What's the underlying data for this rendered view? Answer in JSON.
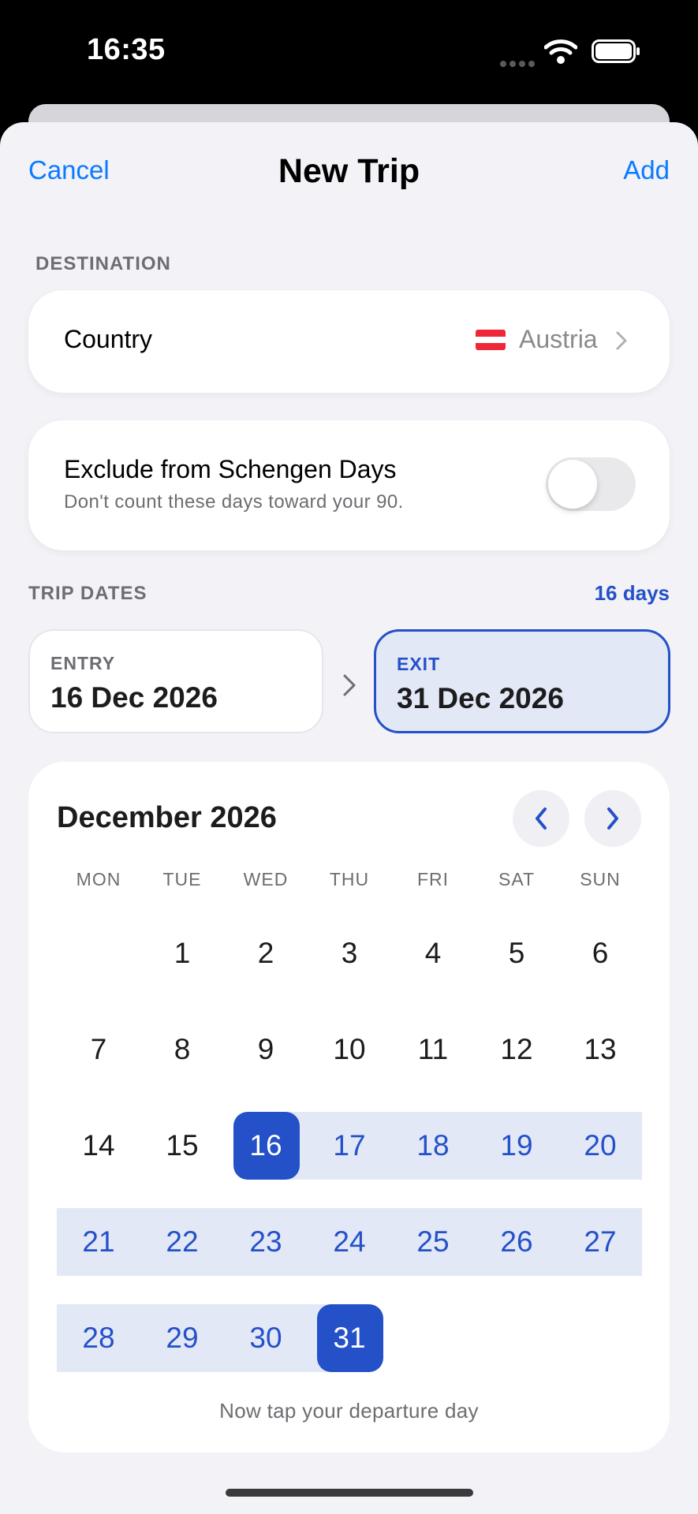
{
  "status_bar": {
    "time": "16:35"
  },
  "nav": {
    "cancel_label": "Cancel",
    "title": "New Trip",
    "add_label": "Add"
  },
  "destination": {
    "section_label": "DESTINATION",
    "country_label": "Country",
    "country_value": "Austria",
    "flag_colors": [
      "#ed2939",
      "#ffffff",
      "#ed2939"
    ]
  },
  "exclude": {
    "title": "Exclude from Schengen Days",
    "subtitle": "Don't count these days toward your 90.",
    "toggle_on": false
  },
  "trip_dates": {
    "section_label": "TRIP DATES",
    "days_count": "16 days",
    "entry": {
      "label": "ENTRY",
      "value": "16 Dec 2026"
    },
    "exit": {
      "label": "EXIT",
      "value": "31 Dec 2026"
    }
  },
  "calendar": {
    "month_title": "December 2026",
    "weekdays": [
      "MON",
      "TUE",
      "WED",
      "THU",
      "FRI",
      "SAT",
      "SUN"
    ],
    "first_weekday_index": 1,
    "days_in_month": 31,
    "range_start": 16,
    "range_end": 31,
    "hint": "Now tap your departure day"
  },
  "colors": {
    "accent": "#2450c8",
    "link": "#0a7aff",
    "range_bg": "#e3e8f7"
  }
}
